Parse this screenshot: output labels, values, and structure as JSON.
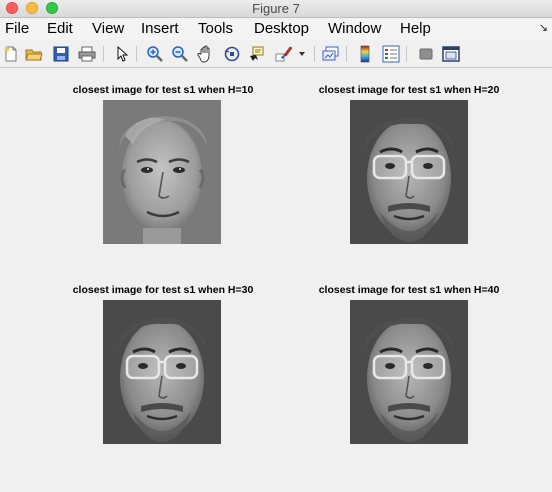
{
  "window": {
    "title": "Figure 7"
  },
  "menu": {
    "items": [
      "File",
      "Edit",
      "View",
      "Insert",
      "Tools",
      "Desktop",
      "Window",
      "Help"
    ],
    "overflow_arrow": "↘"
  },
  "toolbar": {
    "icons": [
      "new-figure-icon",
      "open-file-icon",
      "save-icon",
      "print-icon",
      "pointer-icon",
      "zoom-in-icon",
      "zoom-out-icon",
      "pan-icon",
      "rotate-3d-icon",
      "data-cursor-icon",
      "brush-icon",
      "brush-dropdown-icon",
      "link-plot-icon",
      "insert-colorbar-icon",
      "insert-legend-icon",
      "hide-plot-tools-icon",
      "show-plot-tools-icon"
    ]
  },
  "subplots": [
    {
      "title": "closest image for test s1 when H=10",
      "face": "face-no-glasses"
    },
    {
      "title": "closest image for test s1 when H=20",
      "face": "face-glasses-beard"
    },
    {
      "title": "closest image for test s1 when H=30",
      "face": "face-glasses-beard"
    },
    {
      "title": "closest image for test s1 when H=40",
      "face": "face-glasses-beard"
    }
  ]
}
